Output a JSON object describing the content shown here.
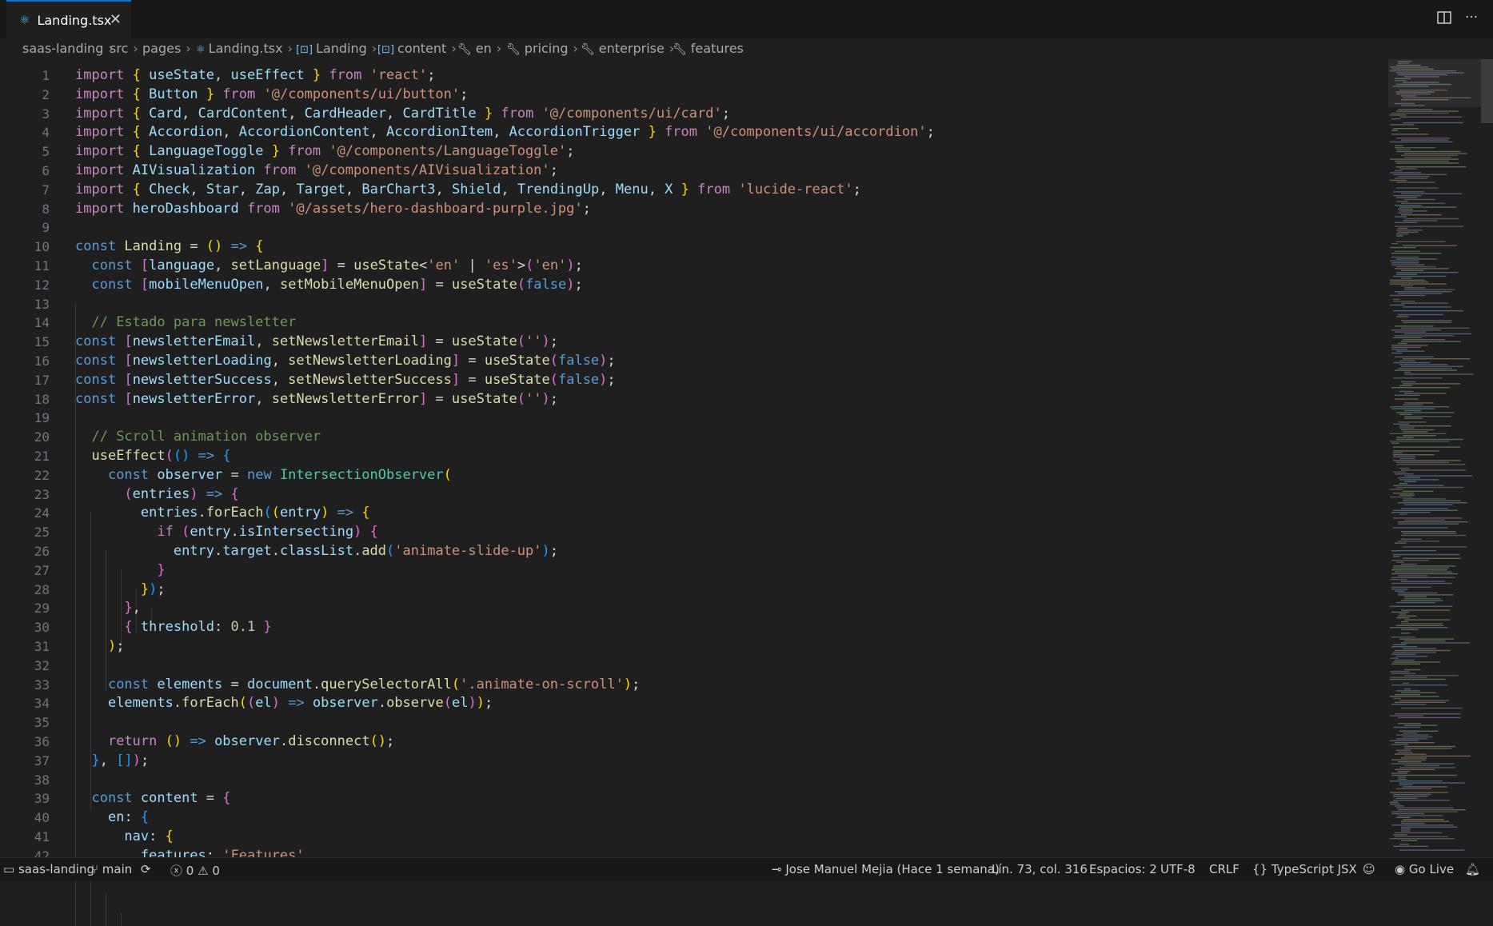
{
  "tab": {
    "icon": "react-icon",
    "label": "Landing.tsx",
    "close": "✕"
  },
  "editor_actions": {
    "split": "▯▯",
    "more": "···"
  },
  "breadcrumb": [
    {
      "label": "saas-landing",
      "icon": ""
    },
    {
      "label": "src",
      "icon": ""
    },
    {
      "label": "pages",
      "icon": ""
    },
    {
      "label": "Landing.tsx",
      "icon": "react-icon"
    },
    {
      "label": "Landing",
      "icon": "symbol-variable-icon"
    },
    {
      "label": "content",
      "icon": "symbol-variable-icon"
    },
    {
      "label": "en",
      "icon": "wrench-icon"
    },
    {
      "label": "pricing",
      "icon": "wrench-icon"
    },
    {
      "label": "enterprise",
      "icon": "wrench-icon"
    },
    {
      "label": "features",
      "icon": "wrench-icon"
    }
  ],
  "status": {
    "remote": "saas-landing",
    "branch": "main",
    "errors": "0",
    "warnings": "0",
    "blame": "Jose Manuel Mejia (Hace 1 semana)",
    "position": "Lín. 73, col. 316",
    "spaces": "Espacios: 2",
    "encoding": "UTF-8",
    "eol": "CRLF",
    "language": "TypeScript JSX",
    "golive": "Go Live"
  },
  "code": [
    [
      [
        "k1",
        "import"
      ],
      [
        "p",
        " "
      ],
      [
        "b1",
        "{"
      ],
      [
        "v",
        " useState"
      ],
      [
        "p",
        ", "
      ],
      [
        "v",
        "useEffect"
      ],
      [
        "p",
        " "
      ],
      [
        "b1",
        "}"
      ],
      [
        "k1",
        " from"
      ],
      [
        "s",
        " 'react'"
      ],
      [
        "p",
        ";"
      ]
    ],
    [
      [
        "k1",
        "import"
      ],
      [
        "p",
        " "
      ],
      [
        "b1",
        "{"
      ],
      [
        "v",
        " Button"
      ],
      [
        "p",
        " "
      ],
      [
        "b1",
        "}"
      ],
      [
        "k1",
        " from"
      ],
      [
        "s",
        " '@/components/ui/button'"
      ],
      [
        "p",
        ";"
      ]
    ],
    [
      [
        "k1",
        "import"
      ],
      [
        "p",
        " "
      ],
      [
        "b1",
        "{"
      ],
      [
        "v",
        " Card"
      ],
      [
        "p",
        ", "
      ],
      [
        "v",
        "CardContent"
      ],
      [
        "p",
        ", "
      ],
      [
        "v",
        "CardHeader"
      ],
      [
        "p",
        ", "
      ],
      [
        "v",
        "CardTitle"
      ],
      [
        "p",
        " "
      ],
      [
        "b1",
        "}"
      ],
      [
        "k1",
        " from"
      ],
      [
        "s",
        " '@/components/ui/card'"
      ],
      [
        "p",
        ";"
      ]
    ],
    [
      [
        "k1",
        "import"
      ],
      [
        "p",
        " "
      ],
      [
        "b1",
        "{"
      ],
      [
        "v",
        " Accordion"
      ],
      [
        "p",
        ", "
      ],
      [
        "v",
        "AccordionContent"
      ],
      [
        "p",
        ", "
      ],
      [
        "v",
        "AccordionItem"
      ],
      [
        "p",
        ", "
      ],
      [
        "v",
        "AccordionTrigger"
      ],
      [
        "p",
        " "
      ],
      [
        "b1",
        "}"
      ],
      [
        "k1",
        " from"
      ],
      [
        "s",
        " '@/components/ui/accordion'"
      ],
      [
        "p",
        ";"
      ]
    ],
    [
      [
        "k1",
        "import"
      ],
      [
        "p",
        " "
      ],
      [
        "b1",
        "{"
      ],
      [
        "v",
        " LanguageToggle"
      ],
      [
        "p",
        " "
      ],
      [
        "b1",
        "}"
      ],
      [
        "k1",
        " from"
      ],
      [
        "s",
        " '@/components/LanguageToggle'"
      ],
      [
        "p",
        ";"
      ]
    ],
    [
      [
        "k1",
        "import"
      ],
      [
        "v",
        " AIVisualization"
      ],
      [
        "k1",
        " from"
      ],
      [
        "s",
        " '@/components/AIVisualization'"
      ],
      [
        "p",
        ";"
      ]
    ],
    [
      [
        "k1",
        "import"
      ],
      [
        "p",
        " "
      ],
      [
        "b1",
        "{"
      ],
      [
        "v",
        " Check"
      ],
      [
        "p",
        ", "
      ],
      [
        "v",
        "Star"
      ],
      [
        "p",
        ", "
      ],
      [
        "v",
        "Zap"
      ],
      [
        "p",
        ", "
      ],
      [
        "v",
        "Target"
      ],
      [
        "p",
        ", "
      ],
      [
        "v",
        "BarChart3"
      ],
      [
        "p",
        ", "
      ],
      [
        "v",
        "Shield"
      ],
      [
        "p",
        ", "
      ],
      [
        "v",
        "TrendingUp"
      ],
      [
        "p",
        ", "
      ],
      [
        "v",
        "Menu"
      ],
      [
        "p",
        ", "
      ],
      [
        "v",
        "X"
      ],
      [
        "p",
        " "
      ],
      [
        "b1",
        "}"
      ],
      [
        "k1",
        " from"
      ],
      [
        "s",
        " 'lucide-react'"
      ],
      [
        "p",
        ";"
      ]
    ],
    [
      [
        "k1",
        "import"
      ],
      [
        "v",
        " heroDashboard"
      ],
      [
        "k1",
        " from"
      ],
      [
        "s",
        " '@/assets/hero-dashboard-purple.jpg'"
      ],
      [
        "p",
        ";"
      ]
    ],
    [],
    [
      [
        "k2",
        "const"
      ],
      [
        "f",
        " Landing"
      ],
      [
        "p",
        " = "
      ],
      [
        "b1",
        "()"
      ],
      [
        "k2",
        " =>"
      ],
      [
        "p",
        " "
      ],
      [
        "b1",
        "{"
      ]
    ],
    [
      [
        "p",
        "  "
      ],
      [
        "k2",
        "const"
      ],
      [
        "p",
        " "
      ],
      [
        "b2",
        "["
      ],
      [
        "v",
        "language"
      ],
      [
        "p",
        ", "
      ],
      [
        "f",
        "setLanguage"
      ],
      [
        "b2",
        "]"
      ],
      [
        "p",
        " = "
      ],
      [
        "f",
        "useState"
      ],
      [
        "p",
        "<"
      ],
      [
        "s",
        "'en'"
      ],
      [
        "p",
        " | "
      ],
      [
        "s",
        "'es'"
      ],
      [
        "p",
        ">"
      ],
      [
        "b2",
        "("
      ],
      [
        "s",
        "'en'"
      ],
      [
        "b2",
        ")"
      ],
      [
        "p",
        ";"
      ]
    ],
    [
      [
        "p",
        "  "
      ],
      [
        "k2",
        "const"
      ],
      [
        "p",
        " "
      ],
      [
        "b2",
        "["
      ],
      [
        "v",
        "mobileMenuOpen"
      ],
      [
        "p",
        ", "
      ],
      [
        "f",
        "setMobileMenuOpen"
      ],
      [
        "b2",
        "]"
      ],
      [
        "p",
        " = "
      ],
      [
        "f",
        "useState"
      ],
      [
        "b2",
        "("
      ],
      [
        "k2",
        "false"
      ],
      [
        "b2",
        ")"
      ],
      [
        "p",
        ";"
      ]
    ],
    [],
    [
      [
        "p",
        "  "
      ],
      [
        "c",
        "// Estado para newsletter"
      ]
    ],
    [
      [
        "k2",
        "const"
      ],
      [
        "p",
        " "
      ],
      [
        "b2",
        "["
      ],
      [
        "v",
        "newsletterEmail"
      ],
      [
        "p",
        ", "
      ],
      [
        "f",
        "setNewsletterEmail"
      ],
      [
        "b2",
        "]"
      ],
      [
        "p",
        " = "
      ],
      [
        "f",
        "useState"
      ],
      [
        "b2",
        "("
      ],
      [
        "s",
        "''"
      ],
      [
        "b2",
        ")"
      ],
      [
        "p",
        ";"
      ]
    ],
    [
      [
        "k2",
        "const"
      ],
      [
        "p",
        " "
      ],
      [
        "b2",
        "["
      ],
      [
        "v",
        "newsletterLoading"
      ],
      [
        "p",
        ", "
      ],
      [
        "f",
        "setNewsletterLoading"
      ],
      [
        "b2",
        "]"
      ],
      [
        "p",
        " = "
      ],
      [
        "f",
        "useState"
      ],
      [
        "b2",
        "("
      ],
      [
        "k2",
        "false"
      ],
      [
        "b2",
        ")"
      ],
      [
        "p",
        ";"
      ]
    ],
    [
      [
        "k2",
        "const"
      ],
      [
        "p",
        " "
      ],
      [
        "b2",
        "["
      ],
      [
        "v",
        "newsletterSuccess"
      ],
      [
        "p",
        ", "
      ],
      [
        "f",
        "setNewsletterSuccess"
      ],
      [
        "b2",
        "]"
      ],
      [
        "p",
        " = "
      ],
      [
        "f",
        "useState"
      ],
      [
        "b2",
        "("
      ],
      [
        "k2",
        "false"
      ],
      [
        "b2",
        ")"
      ],
      [
        "p",
        ";"
      ]
    ],
    [
      [
        "k2",
        "const"
      ],
      [
        "p",
        " "
      ],
      [
        "b2",
        "["
      ],
      [
        "v",
        "newsletterError"
      ],
      [
        "p",
        ", "
      ],
      [
        "f",
        "setNewsletterError"
      ],
      [
        "b2",
        "]"
      ],
      [
        "p",
        " = "
      ],
      [
        "f",
        "useState"
      ],
      [
        "b2",
        "("
      ],
      [
        "s",
        "''"
      ],
      [
        "b2",
        ")"
      ],
      [
        "p",
        ";"
      ]
    ],
    [],
    [
      [
        "p",
        "  "
      ],
      [
        "c",
        "// Scroll animation observer"
      ]
    ],
    [
      [
        "p",
        "  "
      ],
      [
        "f",
        "useEffect"
      ],
      [
        "b2",
        "("
      ],
      [
        "b3",
        "()"
      ],
      [
        "k2",
        " =>"
      ],
      [
        "p",
        " "
      ],
      [
        "b3",
        "{"
      ]
    ],
    [
      [
        "p",
        "    "
      ],
      [
        "k2",
        "const"
      ],
      [
        "v",
        " observer"
      ],
      [
        "p",
        " = "
      ],
      [
        "k2",
        "new"
      ],
      [
        "t",
        " IntersectionObserver"
      ],
      [
        "b1",
        "("
      ]
    ],
    [
      [
        "p",
        "      "
      ],
      [
        "b2",
        "("
      ],
      [
        "v",
        "entries"
      ],
      [
        "b2",
        ")"
      ],
      [
        "k2",
        " =>"
      ],
      [
        "p",
        " "
      ],
      [
        "b2",
        "{"
      ]
    ],
    [
      [
        "p",
        "        "
      ],
      [
        "v",
        "entries"
      ],
      [
        "p",
        "."
      ],
      [
        "f",
        "forEach"
      ],
      [
        "b3",
        "("
      ],
      [
        "b1",
        "("
      ],
      [
        "v",
        "entry"
      ],
      [
        "b1",
        ")"
      ],
      [
        "k2",
        " =>"
      ],
      [
        "p",
        " "
      ],
      [
        "b1",
        "{"
      ]
    ],
    [
      [
        "p",
        "          "
      ],
      [
        "k1",
        "if"
      ],
      [
        "p",
        " "
      ],
      [
        "b2",
        "("
      ],
      [
        "v",
        "entry"
      ],
      [
        "p",
        "."
      ],
      [
        "v",
        "isIntersecting"
      ],
      [
        "b2",
        ")"
      ],
      [
        "p",
        " "
      ],
      [
        "b2",
        "{"
      ]
    ],
    [
      [
        "p",
        "            "
      ],
      [
        "v",
        "entry"
      ],
      [
        "p",
        "."
      ],
      [
        "v",
        "target"
      ],
      [
        "p",
        "."
      ],
      [
        "v",
        "classList"
      ],
      [
        "p",
        "."
      ],
      [
        "f",
        "add"
      ],
      [
        "b3",
        "("
      ],
      [
        "s",
        "'animate-slide-up'"
      ],
      [
        "b3",
        ")"
      ],
      [
        "p",
        ";"
      ]
    ],
    [
      [
        "p",
        "          "
      ],
      [
        "b2",
        "}"
      ]
    ],
    [
      [
        "p",
        "        "
      ],
      [
        "b1",
        "}"
      ],
      [
        "b3",
        ")"
      ],
      [
        "p",
        ";"
      ]
    ],
    [
      [
        "p",
        "      "
      ],
      [
        "b2",
        "}"
      ],
      [
        "p",
        ","
      ]
    ],
    [
      [
        "p",
        "      "
      ],
      [
        "b2",
        "{"
      ],
      [
        "v",
        " threshold"
      ],
      [
        "p",
        ": "
      ],
      [
        "n",
        "0.1"
      ],
      [
        "p",
        " "
      ],
      [
        "b2",
        "}"
      ]
    ],
    [
      [
        "p",
        "    "
      ],
      [
        "b1",
        ")"
      ],
      [
        "p",
        ";"
      ]
    ],
    [],
    [
      [
        "p",
        "    "
      ],
      [
        "k2",
        "const"
      ],
      [
        "v",
        " elements"
      ],
      [
        "p",
        " = "
      ],
      [
        "v",
        "document"
      ],
      [
        "p",
        "."
      ],
      [
        "f",
        "querySelectorAll"
      ],
      [
        "b1",
        "("
      ],
      [
        "s",
        "'.animate-on-scroll'"
      ],
      [
        "b1",
        ")"
      ],
      [
        "p",
        ";"
      ]
    ],
    [
      [
        "p",
        "    "
      ],
      [
        "v",
        "elements"
      ],
      [
        "p",
        "."
      ],
      [
        "f",
        "forEach"
      ],
      [
        "b1",
        "("
      ],
      [
        "b2",
        "("
      ],
      [
        "v",
        "el"
      ],
      [
        "b2",
        ")"
      ],
      [
        "k2",
        " =>"
      ],
      [
        "v",
        " observer"
      ],
      [
        "p",
        "."
      ],
      [
        "f",
        "observe"
      ],
      [
        "b2",
        "("
      ],
      [
        "v",
        "el"
      ],
      [
        "b2",
        ")"
      ],
      [
        "b1",
        ")"
      ],
      [
        "p",
        ";"
      ]
    ],
    [],
    [
      [
        "p",
        "    "
      ],
      [
        "k1",
        "return"
      ],
      [
        "p",
        " "
      ],
      [
        "b1",
        "()"
      ],
      [
        "k2",
        " =>"
      ],
      [
        "v",
        " observer"
      ],
      [
        "p",
        "."
      ],
      [
        "f",
        "disconnect"
      ],
      [
        "b1",
        "()"
      ],
      [
        "p",
        ";"
      ]
    ],
    [
      [
        "p",
        "  "
      ],
      [
        "b3",
        "}"
      ],
      [
        "p",
        ", "
      ],
      [
        "b3",
        "[]"
      ],
      [
        "b2",
        ")"
      ],
      [
        "p",
        ";"
      ]
    ],
    [],
    [
      [
        "p",
        "  "
      ],
      [
        "k2",
        "const"
      ],
      [
        "v",
        " content"
      ],
      [
        "p",
        " = "
      ],
      [
        "b2",
        "{"
      ]
    ],
    [
      [
        "p",
        "    "
      ],
      [
        "v",
        "en"
      ],
      [
        "p",
        ": "
      ],
      [
        "b3",
        "{"
      ]
    ],
    [
      [
        "p",
        "      "
      ],
      [
        "v",
        "nav"
      ],
      [
        "p",
        ": "
      ],
      [
        "b1",
        "{"
      ]
    ],
    [
      [
        "p",
        "        "
      ],
      [
        "v",
        "features"
      ],
      [
        "p",
        ": "
      ],
      [
        "s",
        "'Features'"
      ],
      [
        "p",
        ","
      ]
    ]
  ]
}
